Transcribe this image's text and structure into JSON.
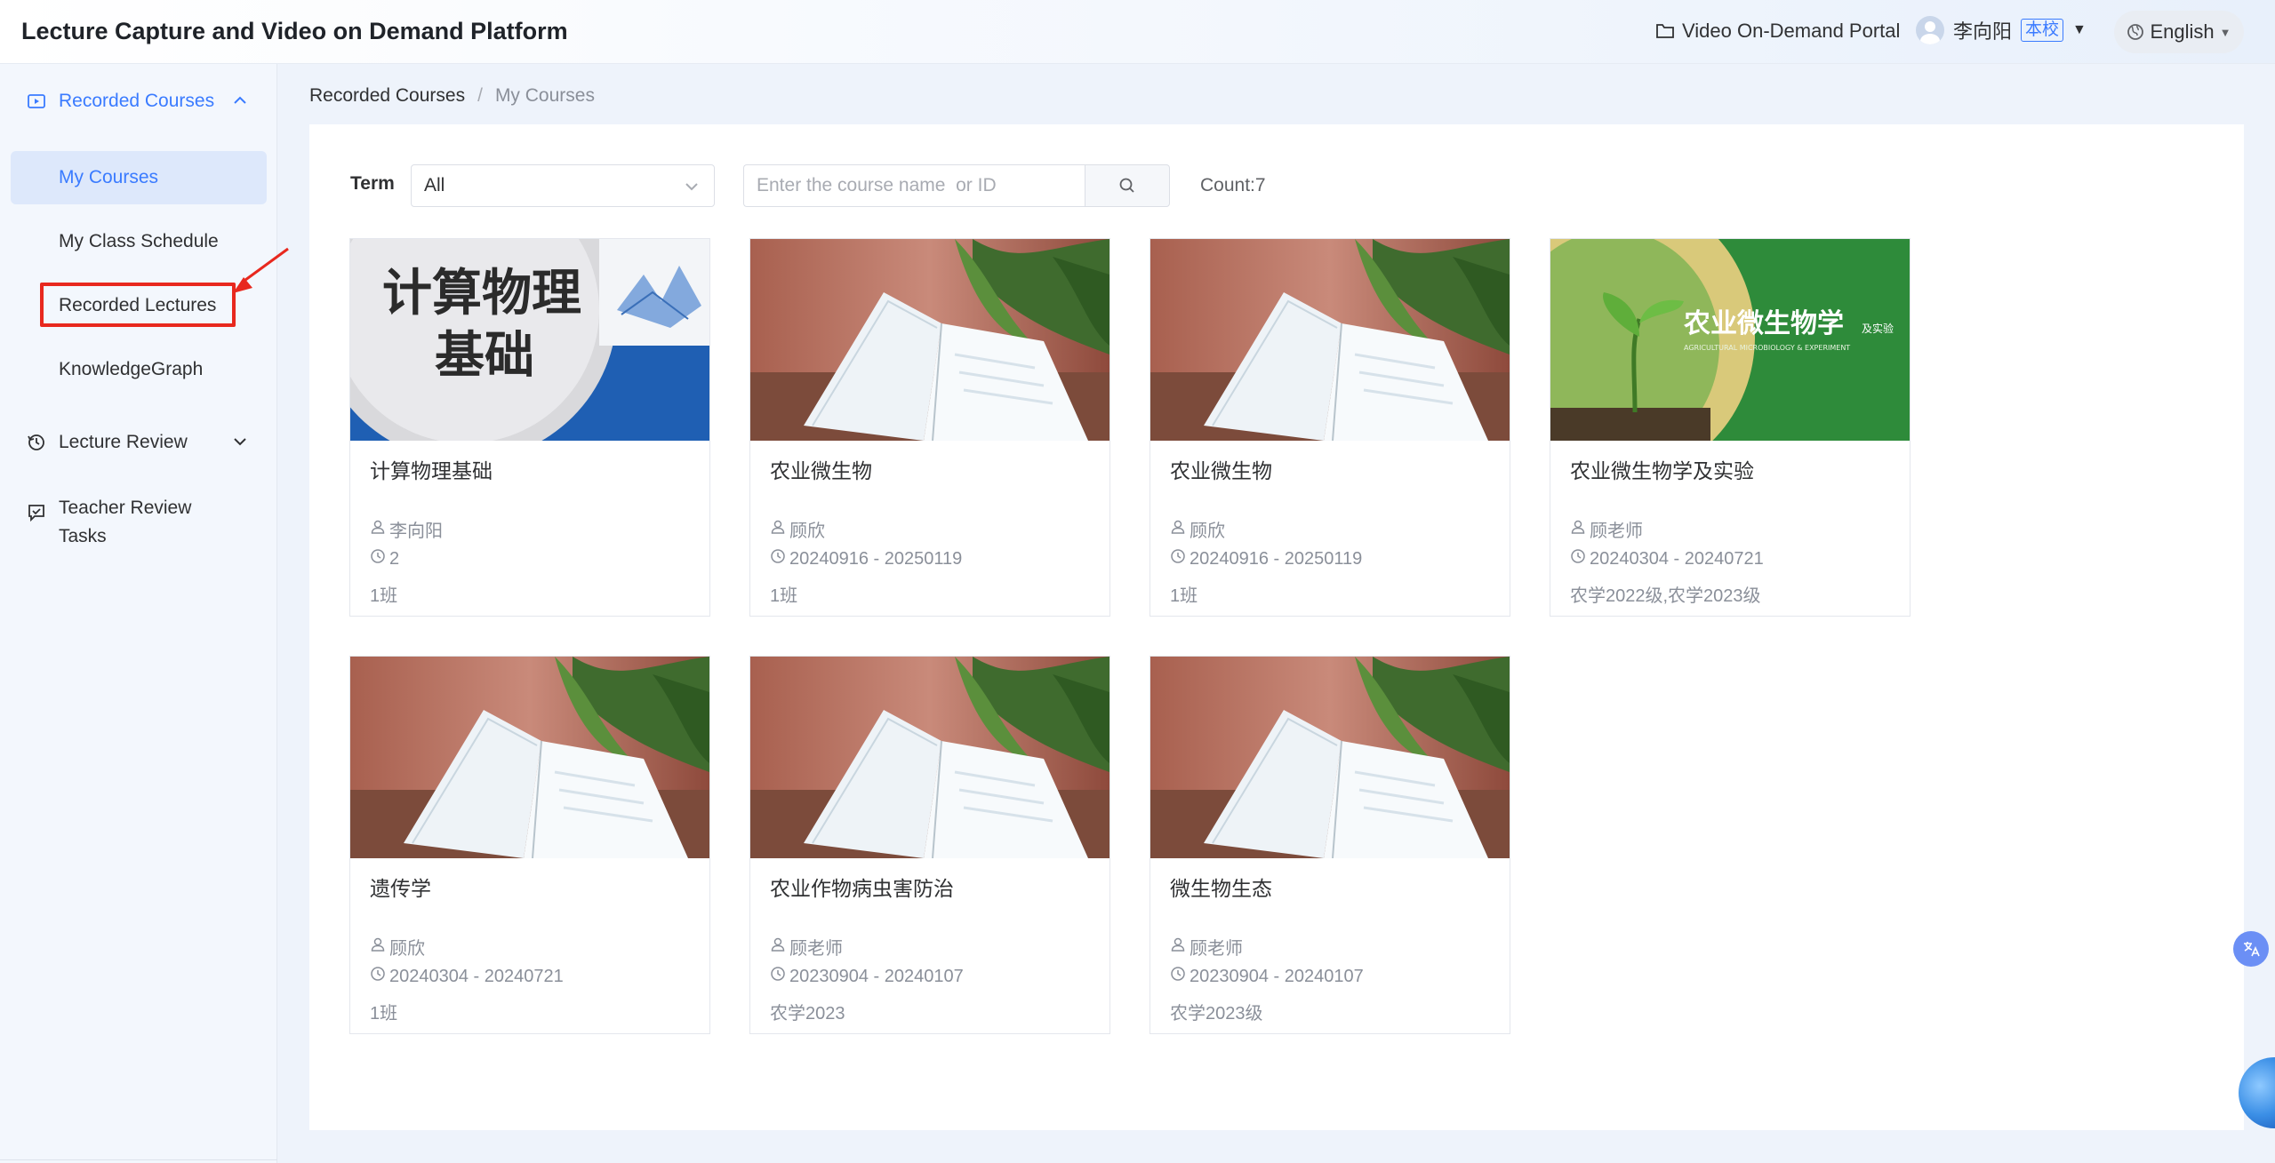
{
  "header": {
    "title": "Lecture Capture and Video on Demand Platform",
    "vod_portal": "Video On-Demand Portal",
    "user_name": "李向阳",
    "school_tag": "本校",
    "language": "English"
  },
  "sidebar": {
    "group_recorded": "Recorded Courses",
    "items": [
      {
        "label": "My Courses"
      },
      {
        "label": "My Class Schedule"
      },
      {
        "label": "Recorded Lectures"
      },
      {
        "label": "KnowledgeGraph"
      }
    ],
    "group_review": "Lecture Review",
    "group_tasks_line1": "Teacher Review",
    "group_tasks_line2": "Tasks"
  },
  "breadcrumb": {
    "parent": "Recorded Courses",
    "separator": "/",
    "current": "My Courses"
  },
  "filters": {
    "term_label": "Term",
    "term_value": "All",
    "search_placeholder": "Enter the course name  or ID",
    "count": "Count:7"
  },
  "courses": [
    {
      "title": "计算物理基础",
      "teacher": "李向阳",
      "period": "2",
      "class": "1班",
      "thumb": "physics",
      "thumb_text_1": "计算物理",
      "thumb_text_2": "基础"
    },
    {
      "title": "农业微生物",
      "teacher": "顾欣",
      "period": "20240916 - 20250119",
      "class": "1班",
      "thumb": "book"
    },
    {
      "title": "农业微生物",
      "teacher": "顾欣",
      "period": "20240916 - 20250119",
      "class": "1班",
      "thumb": "book"
    },
    {
      "title": "农业微生物学及实验",
      "teacher": "顾老师",
      "period": "20240304 - 20240721",
      "class": "农学2022级,农学2023级",
      "thumb": "green",
      "thumb_text_1": "农业微生物学",
      "thumb_text_2": "及实验",
      "thumb_text_3": "AGRICULTURAL MICROBIOLOGY & EXPERIMENT"
    },
    {
      "title": "遗传学",
      "teacher": "顾欣",
      "period": "20240304 - 20240721",
      "class": "1班",
      "thumb": "book"
    },
    {
      "title": "农业作物病虫害防治",
      "teacher": "顾老师",
      "period": "20230904 - 20240107",
      "class": "农学2023",
      "thumb": "book"
    },
    {
      "title": "微生物生态",
      "teacher": "顾老师",
      "period": "20230904 - 20240107",
      "class": "农学2023级",
      "thumb": "book"
    }
  ],
  "icons": {
    "folder": "folder-icon",
    "globe": "globe-icon",
    "user": "user-icon",
    "clock": "clock-icon",
    "search": "search-icon",
    "translate": "translate-icon"
  },
  "colors": {
    "accent": "#3a7bff",
    "highlight_red": "#e8281e",
    "green_banner": "#2e8b3a"
  }
}
